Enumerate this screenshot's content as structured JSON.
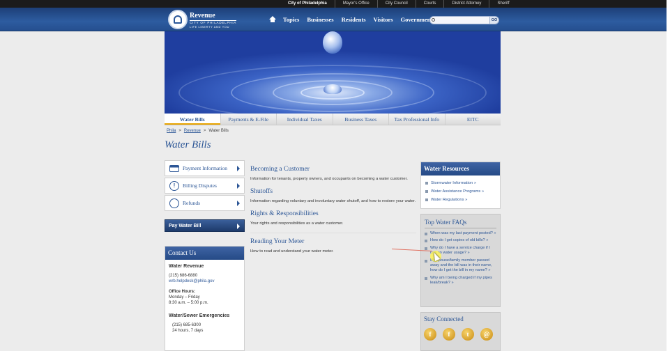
{
  "utility_nav": [
    "City of Philadelphia",
    "Mayor's Office",
    "City Council",
    "Courts",
    "District Attorney",
    "Sheriff"
  ],
  "header": {
    "department": "Revenue",
    "city": "CITY OF PHILADELPHIA",
    "tagline": "LIFE LIBERTY AND YOU",
    "nav": [
      "Topics",
      "Businesses",
      "Residents",
      "Visitors",
      "Government"
    ],
    "search_button": "GO"
  },
  "tabs": [
    "Water Bills",
    "Payments & E-File",
    "Individual Taxes",
    "Business Taxes",
    "Tax Professional Info",
    "EITC"
  ],
  "breadcrumb": {
    "home": "Phila",
    "parent": "Revenue",
    "current": "Water Bills"
  },
  "page_title": "Water Bills",
  "sidebar": {
    "items": [
      "Payment Information",
      "Billing Disputes",
      "Refunds"
    ],
    "pay_button": "Pay Water Bill"
  },
  "contact": {
    "heading": "Contact Us",
    "org": "Water Revenue",
    "phone": "(215) 686-6880",
    "email": "wrb.helpdesk@phila.gov",
    "hours_heading": "Office Hours:",
    "hours_days": "Monday – Friday",
    "hours_time": "8:30 a.m. – 5:00 p.m.",
    "emergency_heading": "Water/Sewer Emergencies",
    "emergency_phone": "(215) 685-6300",
    "emergency_hours": "24 hours, 7 days"
  },
  "content": [
    {
      "title": "Becoming a Customer",
      "text": "Information for tenants, property owners, and occupants on becoming a water customer."
    },
    {
      "title": "Shutoffs",
      "text": "Information regarding voluntary and involuntary water shutoff, and how to restore your water."
    },
    {
      "title": "Rights & Responsibilities",
      "text": "Your rights and responsibilities as a water customer."
    },
    {
      "title": "Reading Your Meter",
      "text": "How to read and understand your water meter."
    }
  ],
  "resources": {
    "heading": "Water Resources",
    "links": [
      "Stormwater Information »",
      "Water Assistance Programs »",
      "Water Regulations »"
    ]
  },
  "faq": {
    "heading": "Top Water FAQs",
    "items": [
      "When was my last payment posted? »",
      "How do I get copies of old bills? »",
      "Why do I have a service charge if I use no water usage? »",
      "My spouse/family member passed away and the bill was in their name, how do I get the bill in my name? »",
      "Why am I being charged if my pipes leak/break? »"
    ]
  },
  "stay_connected": {
    "heading": "Stay Connected",
    "icons": [
      "facebook-icon",
      "facebook-icon",
      "twitter-icon",
      "mail-icon"
    ]
  },
  "colors": {
    "brand_blue": "#2c5696",
    "header_blue": "#254f8f",
    "tab_accent": "#e8a400"
  }
}
